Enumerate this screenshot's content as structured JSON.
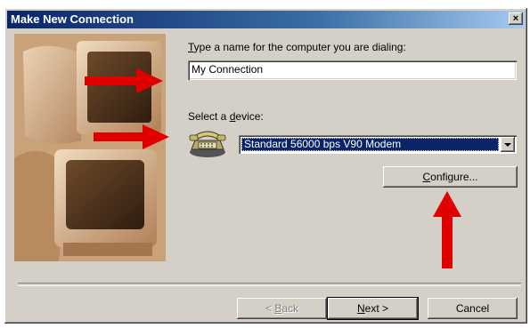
{
  "window": {
    "title": "Make New Connection",
    "close_glyph": "×"
  },
  "form": {
    "name_label_accel": "T",
    "name_label_rest": "ype a name for the computer you are dialing:",
    "name_value": "My Connection",
    "device_label_prefix": "Select a ",
    "device_label_accel": "d",
    "device_label_rest": "evice:",
    "device_value": "Standard 56000 bps V90 Modem"
  },
  "buttons": {
    "configure_accel": "C",
    "configure_rest": "onfigure...",
    "back_prefix": "< ",
    "back_accel": "B",
    "back_rest": "ack",
    "next_accel": "N",
    "next_rest": "ext >",
    "cancel": "Cancel"
  },
  "icons": {
    "phone": "telephone-modem-icon",
    "close": "close-icon"
  },
  "colors": {
    "title_start": "#0a246a",
    "selection": "#0a246a",
    "annotation_arrow": "#e00000",
    "dialog_face": "#d4d0c8"
  }
}
